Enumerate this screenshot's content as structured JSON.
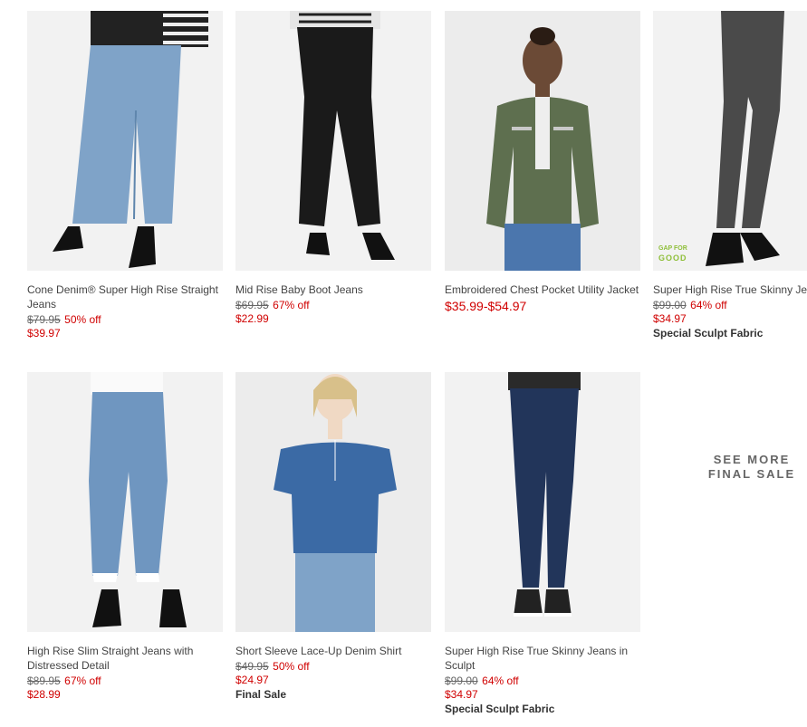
{
  "products": [
    {
      "name": "Cone Denim® Super High Rise Straight Jeans",
      "original_price": "$79.95",
      "percent_off": "50% off",
      "sale_price": "$39.97"
    },
    {
      "name": "Mid Rise Baby Boot Jeans",
      "original_price": "$69.95",
      "percent_off": "67% off",
      "sale_price": "$22.99"
    },
    {
      "name": "Embroidered Chest Pocket Utility Jacket",
      "price_range": "$35.99-$54.97"
    },
    {
      "name": "Super High Rise True Skinny Jeans in Sculpt",
      "original_price": "$99.00",
      "percent_off": "64% off",
      "sale_price": "$34.97",
      "badge": "Special Sculpt Fabric",
      "logo": {
        "line1": "GAP FOR",
        "line2": "GOOD"
      }
    },
    {
      "name": "High Rise Slim Straight Jeans with Distressed Detail",
      "original_price": "$89.95",
      "percent_off": "67% off",
      "sale_price": "$28.99"
    },
    {
      "name": "Short Sleeve Lace-Up Denim Shirt",
      "original_price": "$49.95",
      "percent_off": "50% off",
      "sale_price": "$24.97",
      "badge": "Final Sale"
    },
    {
      "name": "Super High Rise True Skinny Jeans in Sculpt",
      "original_price": "$99.00",
      "percent_off": "64% off",
      "sale_price": "$34.97",
      "badge": "Special Sculpt Fabric"
    }
  ],
  "see_more": {
    "line1": "SEE MORE",
    "line2": "FINAL SALE"
  },
  "colors": {
    "sale_red": "#d00000",
    "strike_gray": "#666666",
    "light_denim": "#7fa3c8",
    "dark_denim": "#22355a",
    "black_denim": "#1a1a1a",
    "olive_jacket": "#5e6f4f",
    "gray_denim": "#4a4a4a",
    "chambray": "#3b6aa5",
    "gap_for_good_green": "#8fbf3a"
  }
}
